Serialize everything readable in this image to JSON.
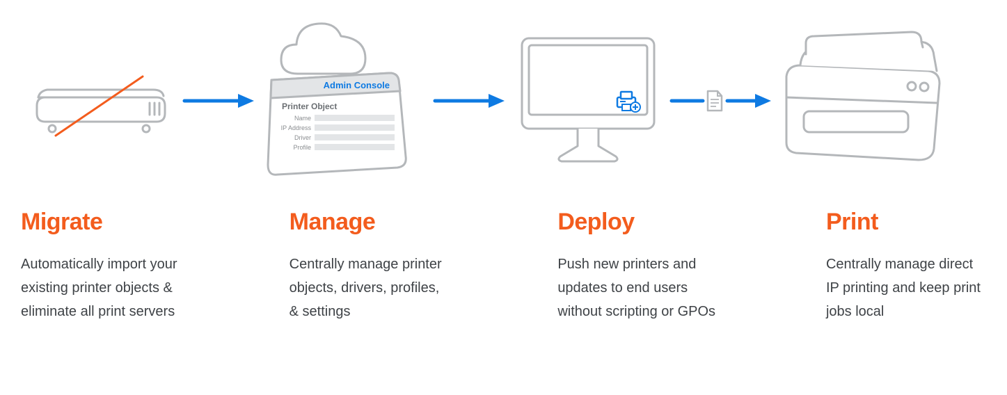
{
  "columns": [
    {
      "title": "Migrate",
      "desc": "Automatically import your existing printer objects & eliminate all print servers"
    },
    {
      "title": "Manage",
      "desc": "Centrally manage printer objects, drivers, profiles, & settings"
    },
    {
      "title": "Deploy",
      "desc": "Push new printers and updates to end users without scripting or GPOs"
    },
    {
      "title": "Print",
      "desc": "Centrally manage direct IP printing and keep print jobs local"
    }
  ],
  "labels": {
    "admin_console": "Admin Console",
    "printer_object": "Printer Object",
    "fields": [
      "Name",
      "IP Address",
      "Driver",
      "Profile"
    ]
  },
  "colors": {
    "orange": "#f35c1d",
    "blue": "#0e7ae2",
    "grey_line": "#b4b7ba",
    "grey_fill": "#e3e5e7"
  }
}
